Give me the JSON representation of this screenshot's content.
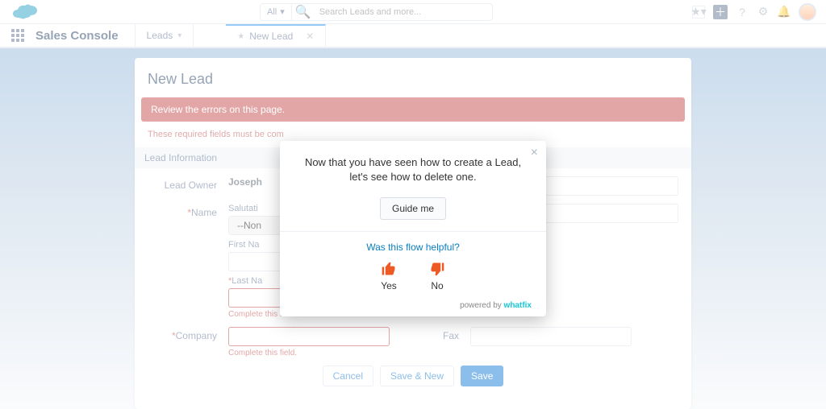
{
  "search": {
    "selector": "All",
    "placeholder": "Search Leads and more..."
  },
  "appName": "Sales Console",
  "tabs": {
    "leads": "Leads",
    "newLead": "New Lead"
  },
  "page": {
    "title": "New Lead",
    "alert": "Review the errors on this page.",
    "requiredMsg": "These required fields must be com",
    "section": "Lead Information",
    "leadOwnerLabel": "Lead Owner",
    "leadOwnerValue": "Joseph",
    "nameLabel": "Name",
    "salutationLabel": "Salutati",
    "salutationValue": "--Non",
    "firstNameLabel": "First Na",
    "lastNameLabel": "Last Na",
    "companyLabel": "Company",
    "faxLabel": "Fax",
    "completeField": "Complete this field."
  },
  "buttons": {
    "cancel": "Cancel",
    "saveNew": "Save & New",
    "save": "Save"
  },
  "modal": {
    "msg": "Now that you have seen how to create a Lead, let's see how to delete one.",
    "guide": "Guide me",
    "helpful": "Was this flow helpful?",
    "yes": "Yes",
    "no": "No",
    "powered": "powered by",
    "brand": "whatfix"
  }
}
